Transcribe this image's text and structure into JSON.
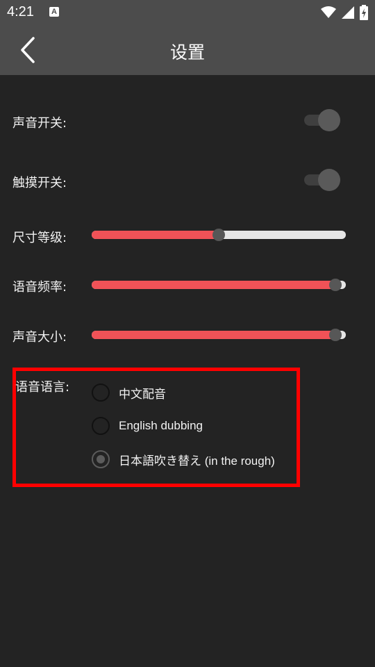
{
  "status_bar": {
    "time": "4:21",
    "notification_icon": "A",
    "icons": [
      "wifi-icon",
      "signal-icon",
      "battery-charging-icon"
    ]
  },
  "app_bar": {
    "back_icon": "chevron-left-icon",
    "title": "设置"
  },
  "settings": {
    "sound_switch": {
      "label": "声音开关:",
      "on": false
    },
    "touch_switch": {
      "label": "触摸开关:",
      "on": false
    },
    "size_level": {
      "label": "尺寸等级:",
      "value_percent": 50
    },
    "voice_rate": {
      "label": "语音频率:",
      "value_percent": 96
    },
    "volume": {
      "label": "声音大小:",
      "value_percent": 96
    }
  },
  "voice_language": {
    "label": "语音语言:",
    "options": [
      {
        "label": "中文配音",
        "checked": false
      },
      {
        "label": "English dubbing",
        "checked": false
      },
      {
        "label": "日本語吹き替え (in the rough)",
        "checked": true
      }
    ]
  },
  "colors": {
    "accent": "#f05257",
    "highlight_border": "#ff0000",
    "app_bar": "#4c4c4c",
    "background": "#232323"
  }
}
